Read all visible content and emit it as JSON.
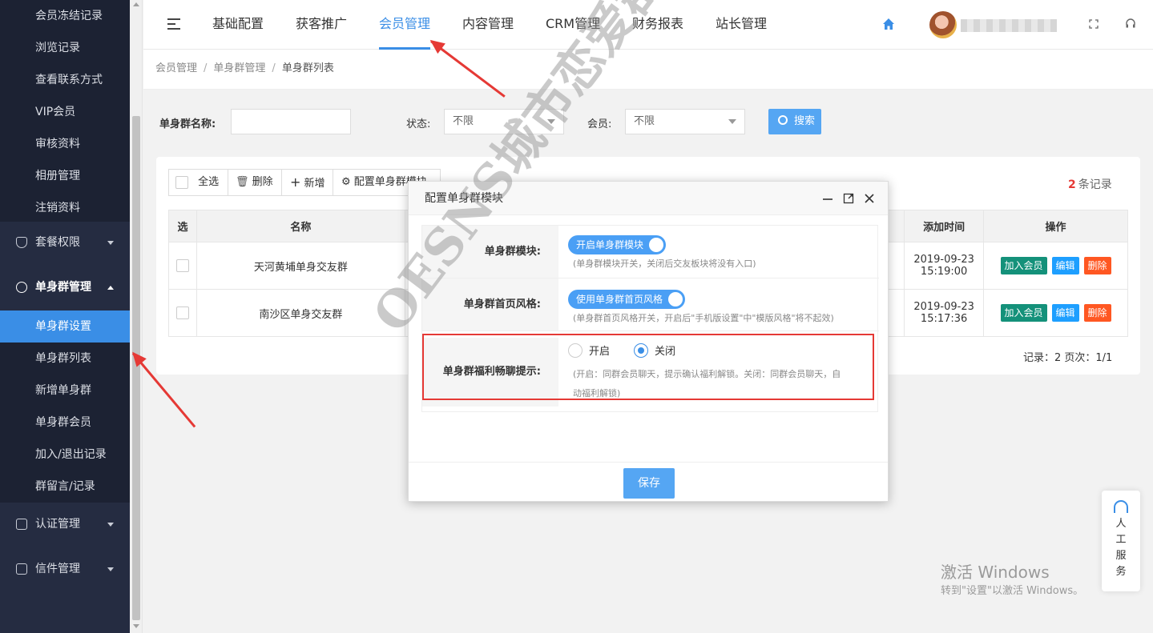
{
  "sidebar": {
    "top_items": [
      "会员冻结记录",
      "浏览记录",
      "查看联系方式",
      "VIP会员",
      "审核资料",
      "相册管理",
      "注销资料"
    ],
    "group_package": "套餐权限",
    "group_single": "单身群管理",
    "single_items": [
      "单身群设置",
      "单身群列表",
      "新增单身群",
      "单身群会员",
      "加入/退出记录",
      "群留言/记录"
    ],
    "group_auth": "认证管理",
    "group_mail": "信件管理"
  },
  "topnav": {
    "items": [
      "基础配置",
      "获客推广",
      "会员管理",
      "内容管理",
      "CRM管理",
      "财务报表",
      "站长管理"
    ],
    "active_index": 2
  },
  "breadcrumb": [
    "会员管理",
    "单身群管理",
    "单身群列表"
  ],
  "filter": {
    "name_label": "单身群名称:",
    "name_value": "",
    "status_label": "状态:",
    "status_value": "不限",
    "member_label": "会员:",
    "member_value": "不限",
    "search_label": "搜索"
  },
  "toolbar": {
    "select_all": "全选",
    "delete": "删除",
    "add": "新增",
    "config": "配置单身群模块"
  },
  "record_count": {
    "count": "2",
    "suffix": "条记录"
  },
  "table": {
    "headers": {
      "select": "选",
      "name": "名称",
      "added": "添加时间",
      "ops": "操作"
    },
    "rows": [
      {
        "name": "天河黄埔单身交友群",
        "date": "2019-09-23",
        "time": "15:19:00"
      },
      {
        "name": "南沙区单身交友群",
        "date": "2019-09-23",
        "time": "15:17:36"
      }
    ],
    "ops": {
      "join": "加入会员",
      "edit": "编辑",
      "delete": "删除"
    }
  },
  "pager": "记录：2  页次：1/1",
  "modal": {
    "title": "配置单身群模块",
    "row1_label": "单身群模块:",
    "row1_toggle": "开启单身群模块",
    "row1_hint": "(单身群模块开关，关闭后交友板块将没有入口)",
    "row2_label": "单身群首页风格:",
    "row2_toggle": "使用单身群首页风格",
    "row2_hint": "(单身群首页风格开关，开启后\"手机版设置\"中\"模版风格\"将不起效)",
    "row3_label": "单身群福利畅聊提示:",
    "radio_on": "开启",
    "radio_off": "关闭",
    "row3_hint_1": "(开启：同群会员聊天，提示确认福利解锁。关闭：同群会员聊天，自",
    "row3_hint_2": "动福利解锁)",
    "save": "保存"
  },
  "watermark": "OESNS城市恋爱群系统",
  "windows_activation": {
    "line1": "激活 Windows",
    "line2": "转到\"设置\"以激活 Windows。"
  },
  "cs_widget": "人工服务",
  "colors": {
    "accent": "#3a8ee6",
    "sidebar": "#252c41",
    "danger": "#e53935",
    "success": "#14917a"
  }
}
